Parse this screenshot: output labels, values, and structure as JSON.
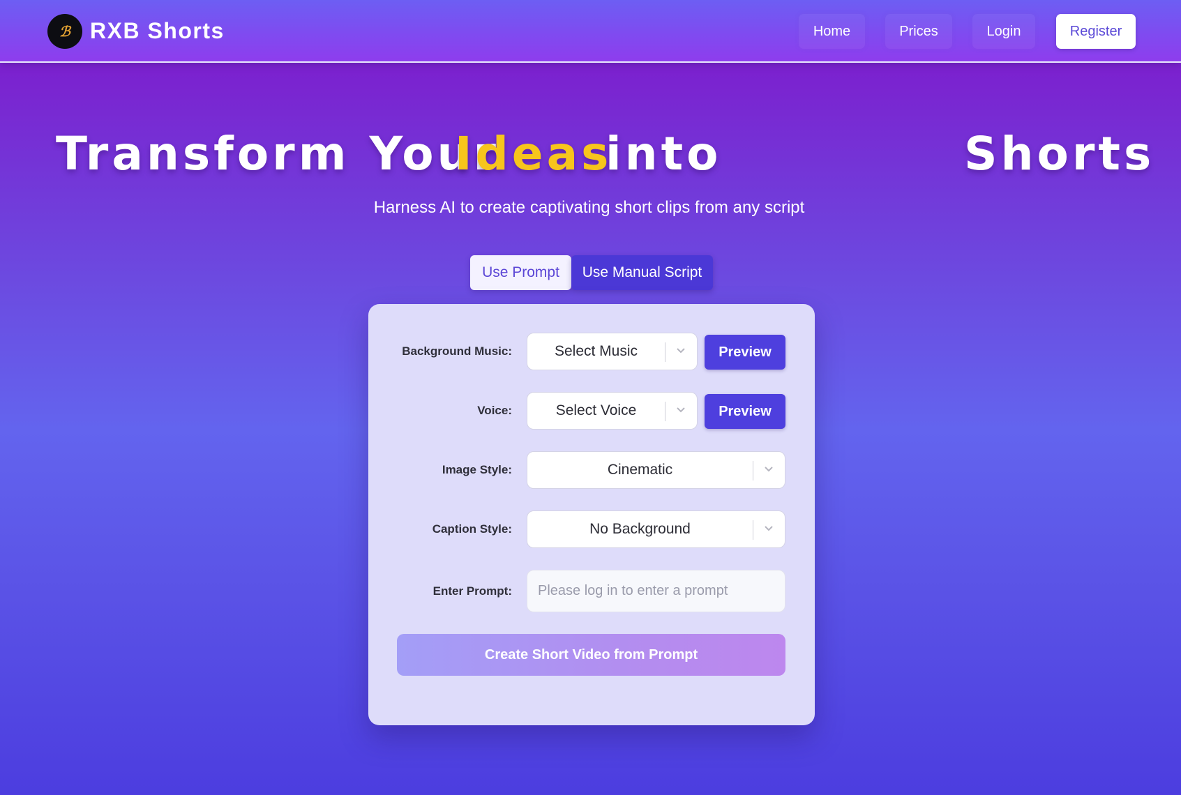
{
  "header": {
    "logo_glyph": "ℬ",
    "brand": "RXB Shorts",
    "nav": {
      "home": "Home",
      "prices": "Prices",
      "login": "Login",
      "register": "Register"
    }
  },
  "hero": {
    "title_part1": "Transform Your",
    "title_highlight": "Ideas",
    "title_part3": "into",
    "title_part4": "Shorts",
    "highlight_color": "#f7c51c",
    "subtitle": "Harness AI to create captivating short clips from any script"
  },
  "tabs": {
    "prompt": "Use Prompt",
    "manual": "Use Manual Script",
    "active": "prompt"
  },
  "form": {
    "music": {
      "label": "Background Music:",
      "value": "Select Music",
      "preview": "Preview"
    },
    "voice": {
      "label": "Voice:",
      "value": "Select Voice",
      "preview": "Preview"
    },
    "image_style": {
      "label": "Image Style:",
      "value": "Cinematic"
    },
    "caption_style": {
      "label": "Caption Style:",
      "value": "No Background"
    },
    "prompt": {
      "label": "Enter Prompt:",
      "placeholder": "Please log in to enter a prompt"
    },
    "submit": "Create Short Video from Prompt"
  },
  "colors": {
    "accent": "#4e3fde",
    "background_top": "#7b22cf",
    "background_bottom": "#4c3ddf",
    "card": "#dedcfa"
  },
  "icons": {
    "logo": "brand-logo-icon",
    "dropdown": "chevron-down-icon"
  }
}
